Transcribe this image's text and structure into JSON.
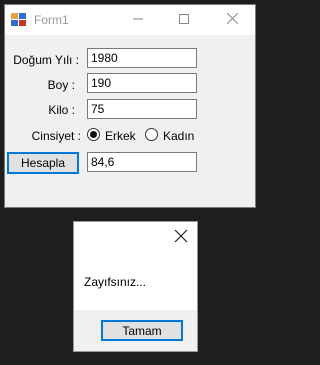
{
  "window": {
    "title": "Form1",
    "minimize_icon": "minimize-icon",
    "maximize_icon": "maximize-icon",
    "close_icon": "close-icon"
  },
  "form": {
    "birth_year_label": "Doğum Yılı :",
    "birth_year_value": "1980",
    "height_label": "Boy :",
    "height_value": "190",
    "weight_label": "Kilo :",
    "weight_value": "75",
    "gender_label": "Cinsiyet :",
    "gender_options": [
      {
        "label": "Erkek",
        "checked": true
      },
      {
        "label": "Kadın",
        "checked": false
      }
    ],
    "calculate_button": "Hesapla",
    "result_value": "84,6"
  },
  "dialog": {
    "message": "Zayıfsınız...",
    "ok_button": "Tamam"
  },
  "colors": {
    "accent": "#0078d7",
    "window_bg": "#f0f0f0",
    "desktop_bg": "#1e1e1e"
  }
}
